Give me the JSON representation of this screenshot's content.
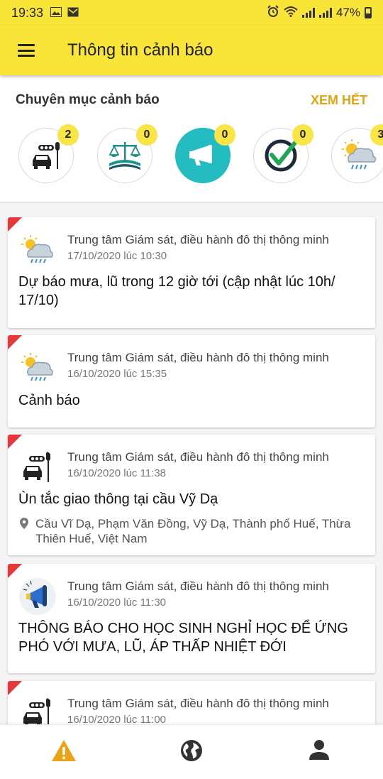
{
  "status_bar": {
    "time": "19:33",
    "battery": "47%"
  },
  "app_bar": {
    "title": "Thông tin cảnh báo",
    "menu_icon": "menu-icon"
  },
  "categories": {
    "heading": "Chuyên mục cảnh báo",
    "see_all": "XEM HẾT",
    "items": [
      {
        "icon": "traffic-icon",
        "count": "2"
      },
      {
        "icon": "law-icon",
        "count": "0"
      },
      {
        "icon": "megaphone-icon",
        "count": "0",
        "active": true
      },
      {
        "icon": "check-icon",
        "count": "0"
      },
      {
        "icon": "weather-icon",
        "count": "3"
      }
    ]
  },
  "alerts": [
    {
      "icon": "weather-icon",
      "source": "Trung tâm Giám sát, điều hành đô thị thông minh",
      "time": "17/10/2020 lúc 10:30",
      "title": "Dự báo mưa, lũ trong 12 giờ tới (cập nhật lúc 10h/ 17/10)"
    },
    {
      "icon": "weather-icon",
      "source": "Trung tâm Giám sát, điều hành đô thị thông minh",
      "time": "16/10/2020 lúc 15:35",
      "title": "Cảnh báo"
    },
    {
      "icon": "traffic-icon",
      "source": "Trung tâm Giám sát, điều hành đô thị thông minh",
      "time": "16/10/2020 lúc 11:38",
      "title": "Ùn tắc giao thông tại cầu Vỹ Dạ",
      "location": "Cầu Vĩ Dạ, Phạm Văn Đồng, Vỹ Dạ, Thành phố Huế, Thừa Thiên Huế, Việt Nam"
    },
    {
      "icon": "megaphone-icon",
      "source": "Trung tâm Giám sát, điều hành đô thị thông minh",
      "time": "16/10/2020 lúc 11:30",
      "title": "THÔNG BÁO CHO HỌC SINH NGHỈ HỌC ĐỂ ỨNG PHÓ VỚI MƯA, LŨ, ÁP THẤP NHIỆT ĐỚI"
    },
    {
      "icon": "traffic-icon",
      "source": "Trung tâm Giám sát, điều hành đô thị thông minh",
      "time": "16/10/2020 lúc 11:00"
    }
  ],
  "bottom_nav": [
    {
      "icon": "warning-icon",
      "active": true,
      "color": "#e8a316"
    },
    {
      "icon": "globe-icon",
      "active": false,
      "color": "#333333"
    },
    {
      "icon": "person-icon",
      "active": false,
      "color": "#333333"
    }
  ]
}
